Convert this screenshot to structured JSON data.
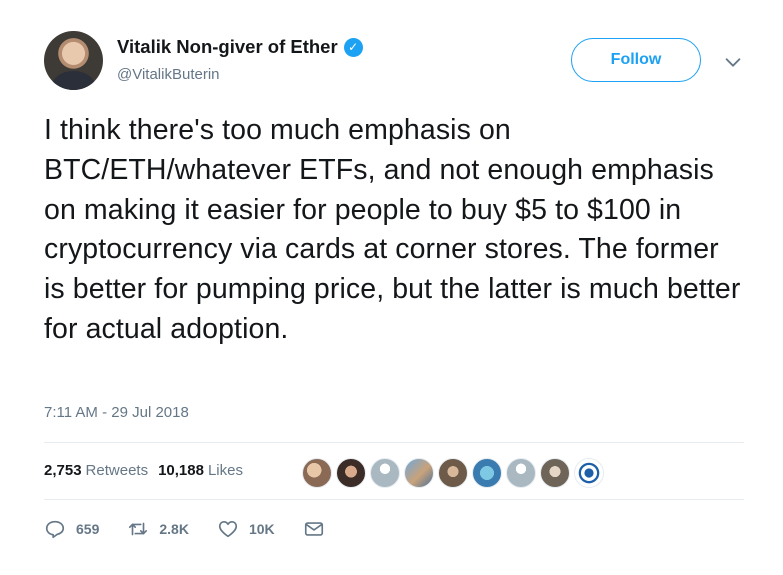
{
  "author": {
    "display_name": "Vitalik Non-giver of Ether",
    "handle": "@VitalikButerin",
    "verified": true
  },
  "follow_label": "Follow",
  "tweet_text": "I think there's too much emphasis on BTC/ETH/whatever ETFs, and not enough emphasis on making it easier for people to buy $5 to $100 in cryptocurrency via cards at corner stores. The former is better for pumping price, but the latter is much better for actual adoption.",
  "timestamp": "7:11 AM - 29 Jul 2018",
  "stats": {
    "retweets_count": "2,753",
    "retweets_label": "Retweets",
    "likes_count": "10,188",
    "likes_label": "Likes"
  },
  "actions": {
    "reply_count": "659",
    "retweet_count": "2.8K",
    "like_count": "10K"
  },
  "colors": {
    "accent": "#1da1f2",
    "text": "#14171a",
    "muted": "#657786",
    "divider": "#e6ecf0"
  }
}
